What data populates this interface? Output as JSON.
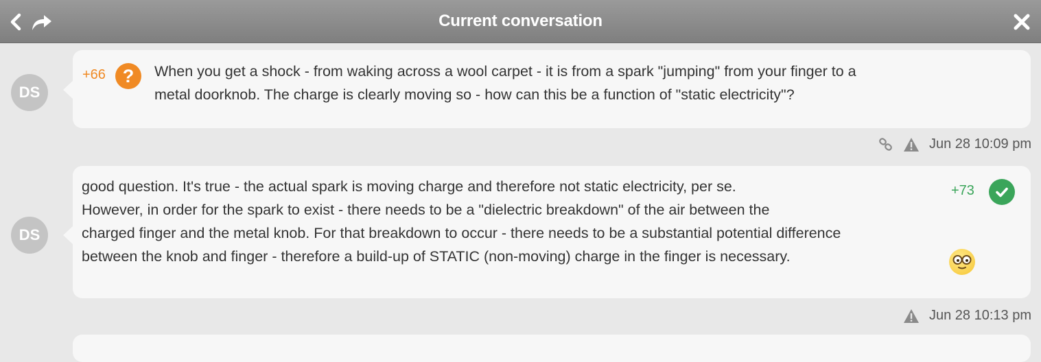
{
  "window": {
    "title": "Current conversation",
    "back_icon": "chevron-left-icon",
    "forward_icon": "share-arrow-icon",
    "close_icon": "close-icon"
  },
  "messages": [
    {
      "avatar": "DS",
      "score": "+66",
      "badge": "?",
      "badge_icon": "question-icon",
      "lines": [
        "When you get a shock - from waking across a wool carpet - it is from a spark \"jumping\" from your finger to a",
        "metal doorknob. The charge is clearly moving so - how can this be a function of \"static electricity\"?"
      ],
      "timestamp": "Jun 28 10:09 pm",
      "meta_icons": [
        "link-icon",
        "warning-icon"
      ]
    },
    {
      "avatar": "DS",
      "score": "+73",
      "badge_icon": "check-icon",
      "lines": [
        "good question. It's true - the actual spark is moving charge and therefore not static electricity, per se.",
        "However, in order for the spark to exist - there needs to be a \"dielectric breakdown\" of the air between the",
        "charged finger and the metal knob. For that breakdown to occur - there needs to be a substantial potential difference",
        "between the knob and finger - therefore a build-up of STATIC (non-moving) charge in the finger is necessary."
      ],
      "emoji": "nerd-face-emoji-icon",
      "timestamp": "Jun 28 10:13 pm",
      "meta_icons": [
        "warning-icon"
      ]
    }
  ],
  "colors": {
    "titlebar": "#8a8a8a",
    "background": "#e8e8e8",
    "bubble": "#f7f7f7",
    "question_accent": "#f08a24",
    "answer_accent": "#3aa55a",
    "avatar": "#c4c4c4"
  }
}
